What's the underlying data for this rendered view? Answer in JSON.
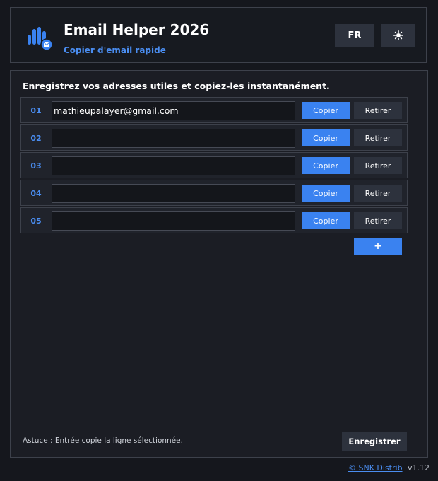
{
  "header": {
    "title": "Email Helper 2026",
    "subtitle": "Copier d'email rapide",
    "lang_label": "FR",
    "theme_icon": "sun-icon",
    "logo_icon": "bar-chart-mail-icon"
  },
  "panel": {
    "title": "Enregistrez vos adresses utiles et copiez-les instantanément.",
    "rows": [
      {
        "num": "01",
        "value": "mathieupalayer@gmail.com"
      },
      {
        "num": "02",
        "value": ""
      },
      {
        "num": "03",
        "value": ""
      },
      {
        "num": "04",
        "value": ""
      },
      {
        "num": "05",
        "value": ""
      }
    ],
    "copy_label": "Copier",
    "remove_label": "Retirer",
    "add_label": "+",
    "tip": "Astuce : Entrée copie la ligne sélectionnée.",
    "save_label": "Enregistrer"
  },
  "footer": {
    "link": "© SNK Distrib",
    "version": "v1.12"
  },
  "colors": {
    "accent": "#3a82f0",
    "accent_text": "#4a8df0",
    "background": "#15171d",
    "button_dark": "#2d323d"
  }
}
